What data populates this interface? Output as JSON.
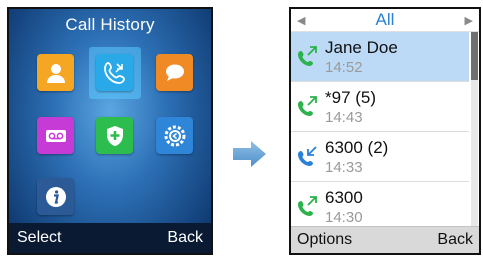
{
  "left_screen": {
    "title": "Call History",
    "apps": [
      {
        "icon": "contacts-icon",
        "color": "#f5a623"
      },
      {
        "icon": "call-history-icon",
        "color": "#29a9e8"
      },
      {
        "icon": "messages-icon",
        "color": "#f08a24"
      },
      {
        "icon": "voicemail-icon",
        "color": "#c63bd6"
      },
      {
        "icon": "security-shield-icon",
        "color": "#2dbd4e"
      },
      {
        "icon": "settings-icon",
        "color": "#2f86d8"
      },
      {
        "icon": "info-icon",
        "color": "#2c5a96"
      }
    ],
    "softkeys": {
      "left": "Select",
      "right": "Back"
    }
  },
  "transition": {
    "icon": "right-arrow-icon"
  },
  "right_screen": {
    "filter": {
      "label": "All",
      "prev_icon": "triangle-left-icon",
      "next_icon": "triangle-right-icon"
    },
    "calls": [
      {
        "name": "Jane Doe",
        "time": "14:52",
        "icon": "outgoing-call-icon",
        "selected": true
      },
      {
        "name": "*97 (5)",
        "time": "14:43",
        "icon": "outgoing-call-icon",
        "selected": false
      },
      {
        "name": "6300 (2)",
        "time": "14:33",
        "icon": "incoming-call-icon",
        "selected": false
      },
      {
        "name": "6300",
        "time": "14:30",
        "icon": "outgoing-call-icon",
        "selected": false
      }
    ],
    "softkeys": {
      "left": "Options",
      "right": "Back"
    },
    "colors": {
      "outgoing": "#2bb24c",
      "incoming": "#2a7fd6",
      "selected_row": "#bcdaf6"
    }
  }
}
